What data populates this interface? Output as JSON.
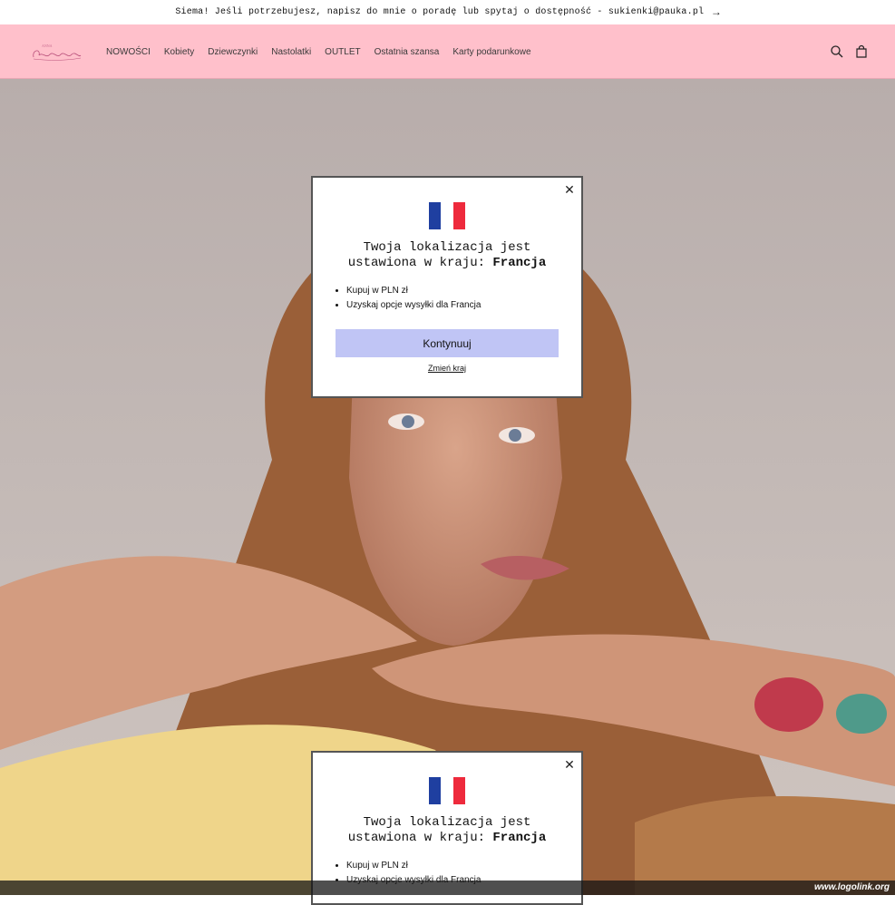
{
  "announcement": {
    "text": "Siema! Jeśli potrzebujesz, napisz do mnie o poradę lub spytaj o dostępność - sukienki@pauka.pl",
    "arrow": "→"
  },
  "header": {
    "logo_text": "Chmielewska",
    "nav": [
      "NOWOŚCI",
      "Kobiety",
      "Dziewczynki",
      "Nastolatki",
      "OUTLET",
      "Ostatnia szansa",
      "Karty podarunkowe"
    ],
    "icons": [
      "search-icon",
      "cart-icon"
    ]
  },
  "modal": {
    "close": "✕",
    "flag_colors": [
      "#1f3fa0",
      "#ffffff",
      "#ee2a3c"
    ],
    "title_line1": "Twoja lokalizacja jest",
    "title_line2": "ustawiona w kraju: ",
    "country": "Francja",
    "bullets": [
      "Kupuj w PLN zł",
      "Uzyskaj opcje wysyłki dla Francja"
    ],
    "button": "Kontynuuj",
    "change_link": "Zmień kraj"
  },
  "watermark": "www.logolink.org",
  "colors": {
    "header_bg": "#ffc0cb",
    "button_bg": "#c0c5f5"
  }
}
